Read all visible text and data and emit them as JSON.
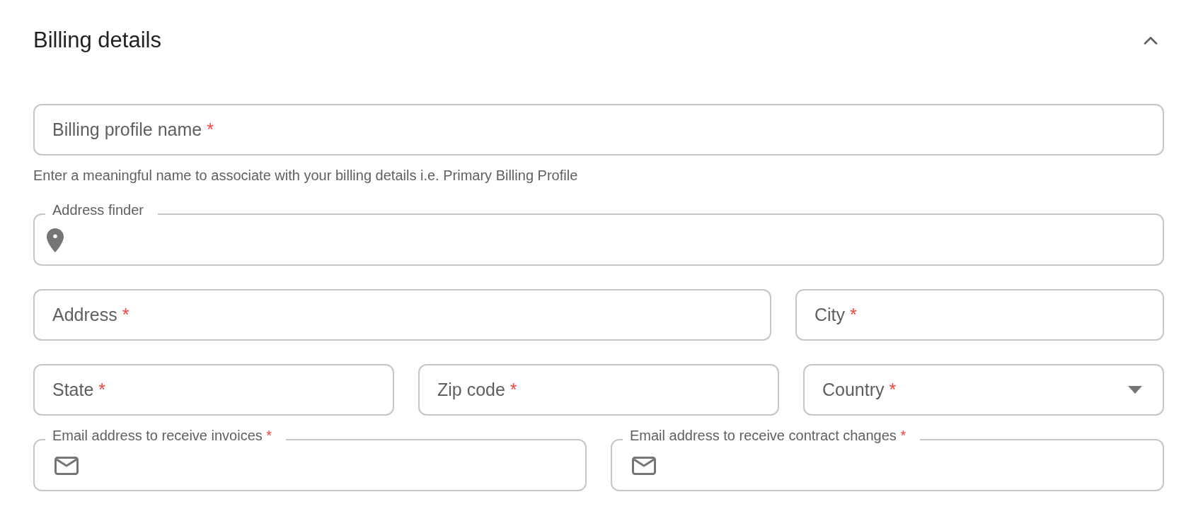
{
  "section": {
    "title": "Billing details",
    "expanded": true
  },
  "rows": [
    {
      "fields": [
        {
          "kind": "text",
          "label": "Billing profile name",
          "required_mark": "*",
          "helper_text": "Enter a meaningful name to associate with your billing details i.e. Primary Billing Profile"
        }
      ]
    },
    {
      "fields": [
        {
          "kind": "location",
          "label": "Address finder"
        }
      ]
    },
    {
      "fields": [
        {
          "kind": "text",
          "label": "Address",
          "required_mark": "*"
        },
        {
          "kind": "text",
          "label": "City",
          "required_mark": "*"
        }
      ]
    },
    {
      "fields": [
        {
          "kind": "text",
          "label": "State",
          "required_mark": "*"
        },
        {
          "kind": "text",
          "label": "Zip code",
          "required_mark": "*"
        },
        {
          "kind": "select",
          "label": "Country",
          "required_mark": "*"
        }
      ]
    },
    {
      "fields": [
        {
          "kind": "email",
          "label": "Email address to receive invoices",
          "required_mark": "*"
        },
        {
          "kind": "email",
          "label": "Email address to receive contract changes",
          "required_mark": "*"
        }
      ]
    }
  ]
}
